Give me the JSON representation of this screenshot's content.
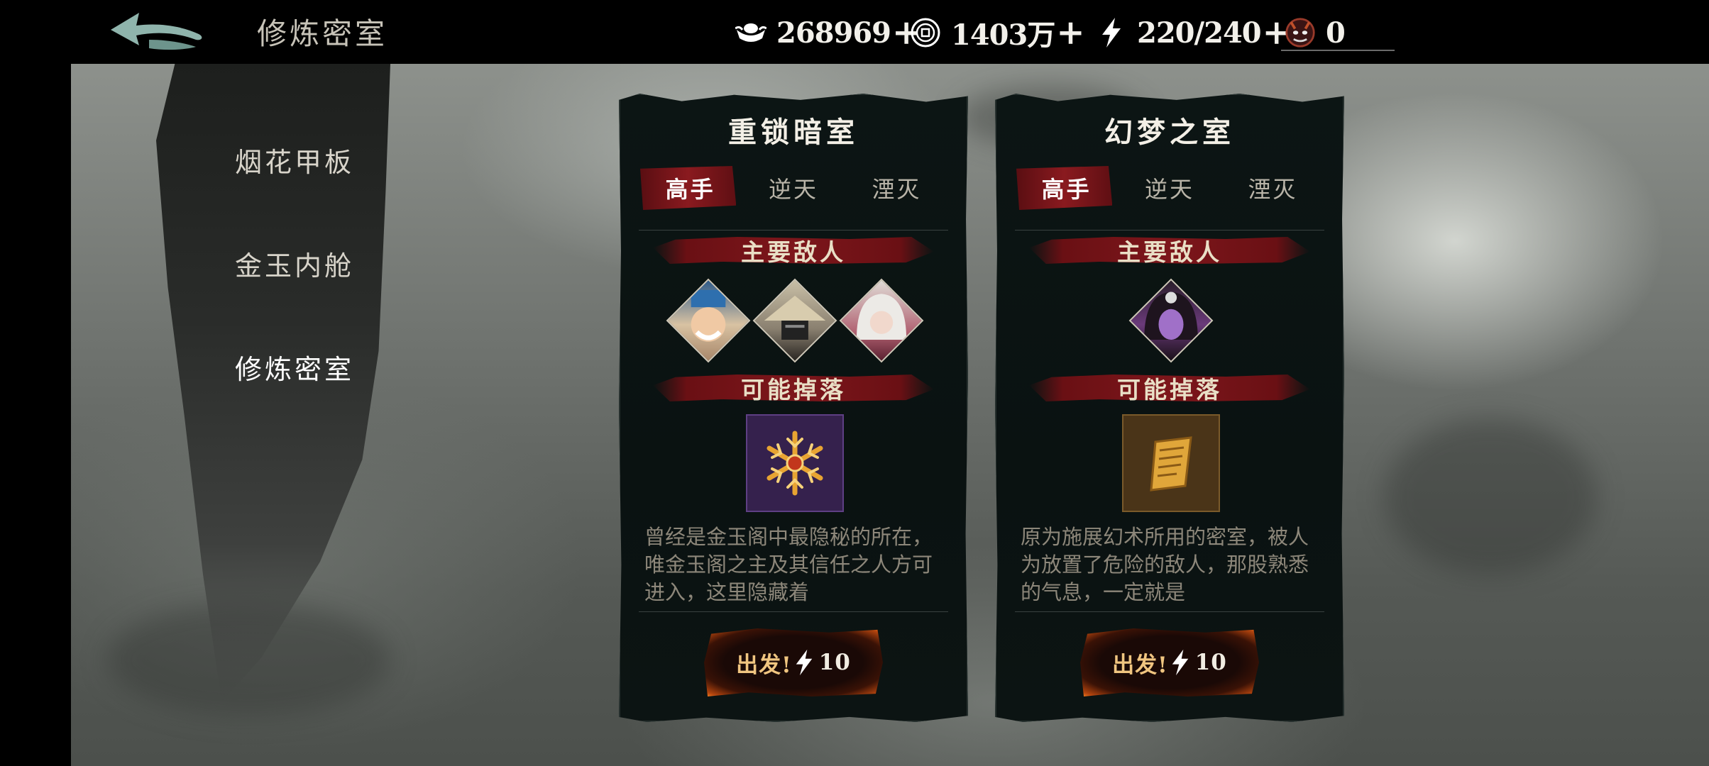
{
  "header": {
    "title": "修炼密室",
    "resources": [
      {
        "icon": "silver-ingot-icon",
        "value": "268969"
      },
      {
        "icon": "coin-icon",
        "value": "1403万"
      },
      {
        "icon": "lightning-icon",
        "value": "220/240"
      },
      {
        "icon": "demon-mask-icon",
        "value": "0"
      }
    ],
    "plus_label": "+"
  },
  "sidebar": {
    "items": [
      {
        "label": "烟花甲板",
        "active": false
      },
      {
        "label": "金玉内舱",
        "active": false
      },
      {
        "label": "修炼密室",
        "active": true
      }
    ]
  },
  "cards": [
    {
      "title": "重锁暗室",
      "tabs": [
        {
          "label": "高手",
          "active": true
        },
        {
          "label": "逆天",
          "active": false
        },
        {
          "label": "湮灭",
          "active": false
        }
      ],
      "enemies_label": "主要敌人",
      "enemies": [
        "old-official-portrait",
        "straw-hat-assassin-portrait",
        "white-haired-woman-portrait"
      ],
      "drops_label": "可能掉落",
      "drops": [
        "golden-snowflake-item"
      ],
      "description": "曾经是金玉阁中最隐秘的所在，唯金玉阁之主及其信任之人方可进入，这里隐藏着",
      "go_label": "出发!",
      "cost": "10"
    },
    {
      "title": "幻梦之室",
      "tabs": [
        {
          "label": "高手",
          "active": true
        },
        {
          "label": "逆天",
          "active": false
        },
        {
          "label": "湮灭",
          "active": false
        }
      ],
      "enemies_label": "主要敌人",
      "enemies": [
        "purple-demon-woman-portrait"
      ],
      "drops_label": "可能掉落",
      "drops": [
        "golden-scroll-item"
      ],
      "description": "原为施展幻术所用的密室，被人为放置了危险的敌人，那股熟悉的气息，一定就是",
      "go_label": "出发!",
      "cost": "10"
    }
  ],
  "colors": {
    "accent_red": "#8a1a1f",
    "button_glow": "#ff8a25",
    "card_bg": "#0a1211"
  }
}
